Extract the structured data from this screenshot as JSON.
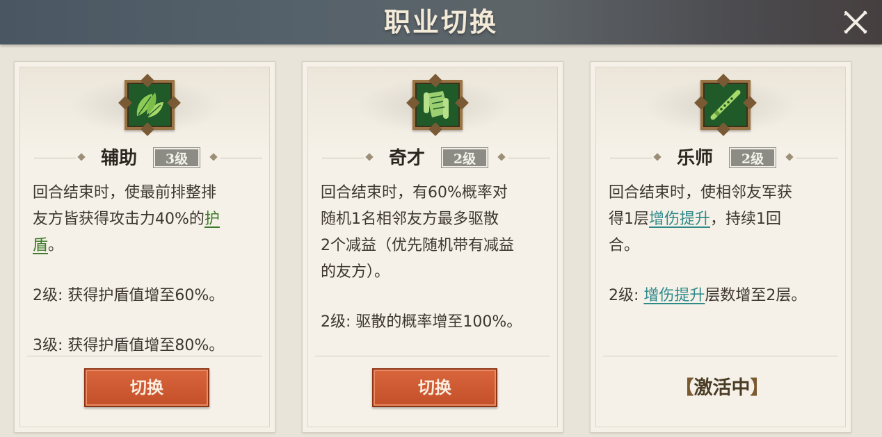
{
  "header": {
    "title": "职业切换"
  },
  "cards": [
    {
      "name": "辅助",
      "level": "3级",
      "desc_lines": [
        "回合结束时，使最前排整排",
        "友方皆获得攻击力40%的"
      ],
      "keyword_a": "护",
      "keyword_b": "盾",
      "desc_tail": "。",
      "upgrade_1": "2级: 获得护盾值增至60%。",
      "upgrade_2": "3级: 获得护盾值增至80%。",
      "button": "切换",
      "icon": "leaf-icon"
    },
    {
      "name": "奇才",
      "level": "2级",
      "desc_lines": [
        "回合结束时，有60%概率对",
        "随机1名相邻友方最多驱散",
        "2个减益（优先随机带有减益",
        "的友方）。"
      ],
      "upgrade_1": "2级: 驱散的概率增至100%。",
      "button": "切换",
      "icon": "scroll-icon"
    },
    {
      "name": "乐师",
      "level": "2级",
      "desc_line_1": "回合结束时，使相邻友军获",
      "desc_prefix_2": "得1层",
      "keyword": "增伤提升",
      "desc_suffix_2": "，持续1回",
      "desc_line_3": "合。",
      "upgrade_prefix": "2级: ",
      "upgrade_keyword": "增伤提升",
      "upgrade_suffix": "层数增至2层。",
      "status": "激活中",
      "icon": "flute-icon"
    }
  ],
  "colors": {
    "accent_button": "#c4502a",
    "keyword_green": "#3e7a2c",
    "keyword_teal": "#2f8a8a",
    "emblem_green": "#1f5a28"
  }
}
